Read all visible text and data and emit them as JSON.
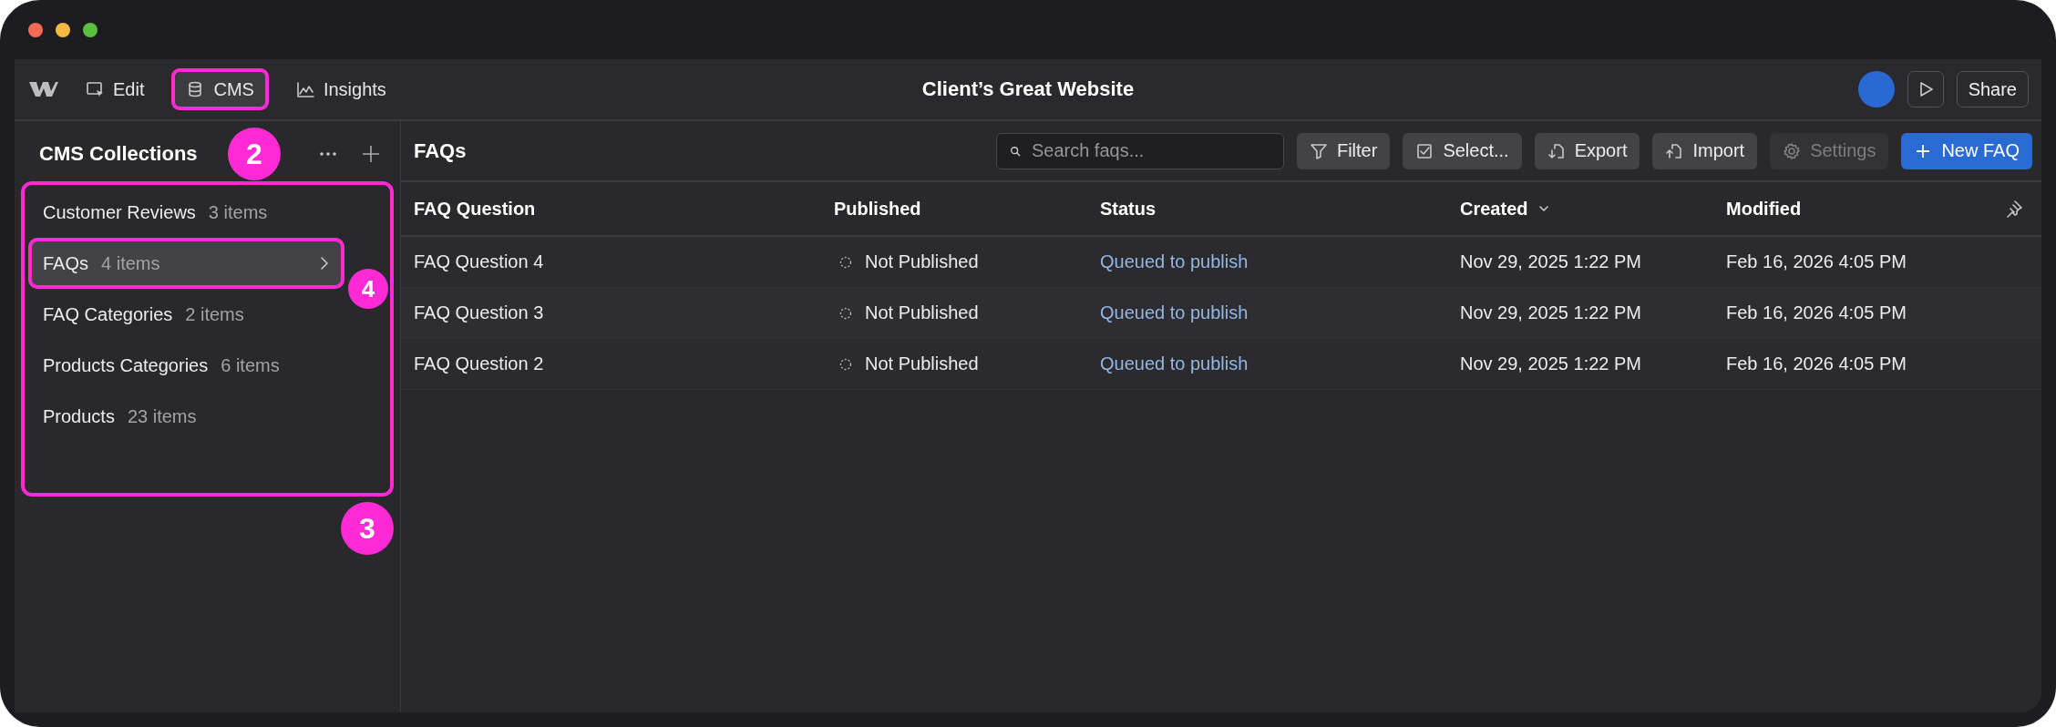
{
  "window": {
    "title": "Client’s Great Website"
  },
  "nav": [
    {
      "label": "Edit",
      "selected": false
    },
    {
      "label": "CMS",
      "selected": true,
      "callout": "2"
    },
    {
      "label": "Insights",
      "selected": false
    }
  ],
  "top_actions": {
    "share": "Share"
  },
  "sidebar": {
    "title": "CMS Collections",
    "callout": "3",
    "items": [
      {
        "name": "Customer Reviews",
        "count": "3 items",
        "selected": false
      },
      {
        "name": "FAQs",
        "count": "4 items",
        "selected": true,
        "callout": "4"
      },
      {
        "name": "FAQ Categories",
        "count": "2 items",
        "selected": false
      },
      {
        "name": "Products Categories",
        "count": "6 items",
        "selected": false
      },
      {
        "name": "Products",
        "count": "23 items",
        "selected": false
      }
    ]
  },
  "collection": {
    "title": "FAQs",
    "search": {
      "placeholder": "Search faqs..."
    },
    "buttons": [
      {
        "label": "Filter",
        "kind": "normal",
        "disabled": false
      },
      {
        "label": "Select...",
        "kind": "normal",
        "disabled": false
      },
      {
        "label": "Export",
        "kind": "normal",
        "disabled": false
      },
      {
        "label": "Import",
        "kind": "normal",
        "disabled": false
      },
      {
        "label": "Settings",
        "kind": "normal",
        "disabled": true
      },
      {
        "label": "New FAQ",
        "kind": "primary",
        "disabled": false
      }
    ]
  },
  "table": {
    "columns": [
      {
        "label": "FAQ Question",
        "sorted": false
      },
      {
        "label": "Published",
        "sorted": false
      },
      {
        "label": "Status",
        "sorted": false
      },
      {
        "label": "Created",
        "sorted": true
      },
      {
        "label": "Modified",
        "sorted": false
      }
    ],
    "rows": [
      {
        "cells": [
          "FAQ Question 4",
          "Not Published",
          "Queued to publish",
          "Nov 29, 2025 1:22 PM",
          "Feb 16, 2026 4:05 PM"
        ]
      },
      {
        "cells": [
          "FAQ Question 3",
          "Not Published",
          "Queued to publish",
          "Nov 29, 2025 1:22 PM",
          "Feb 16, 2026 4:05 PM"
        ]
      },
      {
        "cells": [
          "FAQ Question 2",
          "Not Published",
          "Queued to publish",
          "Nov 29, 2025 1:22 PM",
          "Feb 16, 2026 4:05 PM"
        ]
      }
    ]
  }
}
